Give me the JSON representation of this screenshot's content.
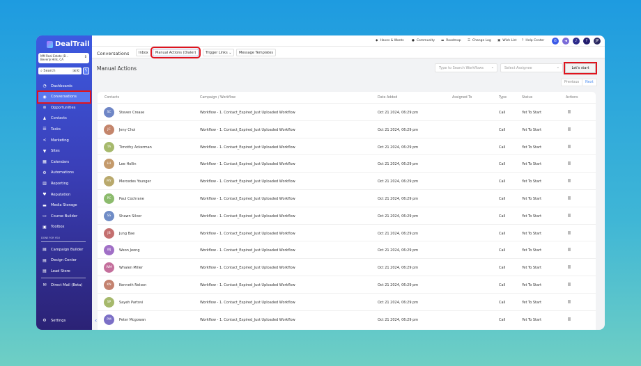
{
  "brand": {
    "name": "DealTrail"
  },
  "account": {
    "name": "MM Real Estate (B...",
    "location": "Beverly Hills, CA"
  },
  "search": {
    "placeholder": "Search",
    "shortcut": "⌘ K"
  },
  "sidebar": {
    "items": [
      {
        "label": "Dashboards",
        "icon": "gauge-icon"
      },
      {
        "label": "Conversations",
        "icon": "chat-icon",
        "active": true
      },
      {
        "label": "Opportunities",
        "icon": "opportunities-icon"
      },
      {
        "label": "Contacts",
        "icon": "contacts-icon"
      },
      {
        "label": "Tasks",
        "icon": "list-icon"
      },
      {
        "label": "Marketing",
        "icon": "share-icon"
      },
      {
        "label": "Sites",
        "icon": "filter-icon"
      },
      {
        "label": "Calendars",
        "icon": "calendar-icon"
      },
      {
        "label": "Automations",
        "icon": "gears-icon"
      },
      {
        "label": "Reporting",
        "icon": "chart-icon"
      },
      {
        "label": "Reputation",
        "icon": "heart-icon"
      },
      {
        "label": "Media Storage",
        "icon": "folder-icon"
      },
      {
        "label": "Course Builder",
        "icon": "monitor-icon"
      },
      {
        "label": "Toolbox",
        "icon": "toolbox-icon"
      }
    ],
    "section_label": "DONE FOR YOU",
    "dfy_items": [
      {
        "label": "Campaign Builder"
      },
      {
        "label": "Design Center"
      },
      {
        "label": "Lead Store"
      }
    ],
    "extra_items": [
      {
        "label": "Direct Mail (Beta)"
      }
    ],
    "settings": "Settings"
  },
  "topbar": {
    "links": [
      "Haves & Wants",
      "Community",
      "Roadmap",
      "Change Log",
      "Wish List",
      "Help Center"
    ],
    "avatar": "JP"
  },
  "subnav": {
    "title": "Conversations",
    "tabs": [
      "Inbox",
      "Manual Actions (Dialer)",
      "Trigger Links",
      "Message Templates"
    ]
  },
  "page": {
    "title": "Manual Actions",
    "workflow_placeholder": "Type to Search Workflows",
    "assignee_placeholder": "Select Assignee",
    "start_label": "Let's start",
    "prev": "Previous",
    "next": "Next"
  },
  "table": {
    "headers": [
      "Contacts",
      "Campaign / Workflow",
      "Date Added",
      "Assigned To",
      "Type",
      "Status",
      "Actions"
    ],
    "rows": [
      {
        "initials": "SC",
        "name": "Steven Crease",
        "color": "#6f86c6"
      },
      {
        "initials": "JC",
        "name": "Jeny Choi",
        "color": "#c4856b"
      },
      {
        "initials": "TA",
        "name": "Timothy Ackerman",
        "color": "#a6b96c"
      },
      {
        "initials": "LH",
        "name": "Lee Hollin",
        "color": "#c49a6b"
      },
      {
        "initials": "MY",
        "name": "Mercedes Younger",
        "color": "#b9a96c"
      },
      {
        "initials": "PC",
        "name": "Paul Cochrane",
        "color": "#8cbb6d"
      },
      {
        "initials": "SS",
        "name": "Shawn Silver",
        "color": "#6f8cc6"
      },
      {
        "initials": "JB",
        "name": "Jung Bae",
        "color": "#c46f6f"
      },
      {
        "initials": "WJ",
        "name": "Weon Jeong",
        "color": "#a06fc6"
      },
      {
        "initials": "WM",
        "name": "Whalen Miller",
        "color": "#c46f9c"
      },
      {
        "initials": "KN",
        "name": "Kenneth Nelson",
        "color": "#c4826f"
      },
      {
        "initials": "SP",
        "name": "Sayeh Partovi",
        "color": "#a6b96c"
      },
      {
        "initials": "PM",
        "name": "Peter Mcgowan",
        "color": "#7b6fc6"
      }
    ],
    "workflow": "Workflow - 1. Contact_Expired_Just Uploaded Workflow",
    "date": "Oct 21 2024, 06:29 pm",
    "type": "Call",
    "status": "Yet To Start"
  }
}
